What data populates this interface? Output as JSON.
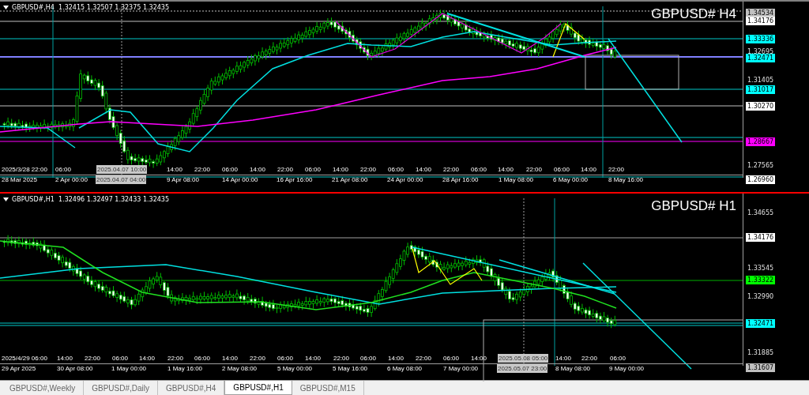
{
  "panels": [
    {
      "active": false,
      "header": "GBPUSD#,H4  1.32415 1.32507 1.32375 1.32435",
      "title": "GBPUSD# H4",
      "price_labels": [
        {
          "text": "1.34534",
          "kind": "box",
          "color": "#c0c0c0"
        },
        {
          "text": "1.34176",
          "kind": "box",
          "color": "#ffffff"
        },
        {
          "text": "1.33336",
          "kind": "box",
          "color": "#00ffff"
        },
        {
          "text": "1.32695",
          "kind": "plain"
        },
        {
          "text": "1.32471",
          "kind": "box",
          "color": "#00ffff"
        },
        {
          "text": "1.31405",
          "kind": "plain"
        },
        {
          "text": "1.31017",
          "kind": "box",
          "color": "#00ffff"
        },
        {
          "text": "1.30270",
          "kind": "box",
          "color": "#ffffff"
        },
        {
          "text": "1.28667",
          "kind": "box",
          "color": "#ff00ff"
        },
        {
          "text": "1.27565",
          "kind": "plain"
        },
        {
          "text": "1.26960",
          "kind": "box",
          "color": "#ffffff"
        }
      ],
      "hour_labels": [
        {
          "text": "2025/3/28 22:00",
          "highlighted": false
        },
        {
          "text": "06:00",
          "highlighted": false
        },
        {
          "text": "2025.04.07 10:00",
          "highlighted": true
        },
        {
          "text": "14:00",
          "highlighted": false
        },
        {
          "text": "22:00",
          "highlighted": false
        },
        {
          "text": "06:00",
          "highlighted": false
        },
        {
          "text": "14:00",
          "highlighted": false
        },
        {
          "text": "22:00",
          "highlighted": false
        },
        {
          "text": "06:00",
          "highlighted": false
        },
        {
          "text": "14:00",
          "highlighted": false
        },
        {
          "text": "22:00",
          "highlighted": false
        },
        {
          "text": "06:00",
          "highlighted": false
        },
        {
          "text": "14:00",
          "highlighted": false
        },
        {
          "text": "22:00",
          "highlighted": false
        },
        {
          "text": "06:00",
          "highlighted": false
        },
        {
          "text": "14:00",
          "highlighted": false
        },
        {
          "text": "22:00",
          "highlighted": false
        },
        {
          "text": "06:00",
          "highlighted": false
        },
        {
          "text": "14:00",
          "highlighted": false
        },
        {
          "text": "22:00",
          "highlighted": false
        }
      ],
      "date_labels": [
        {
          "text": "28 Mar 2025",
          "highlighted": false
        },
        {
          "text": "2 Apr 00:00",
          "highlighted": false
        },
        {
          "text": "2025.04.07 04:00",
          "highlighted": true
        },
        {
          "text": "9 Apr 08:00",
          "highlighted": false
        },
        {
          "text": "14 Apr 00:00",
          "highlighted": false
        },
        {
          "text": "16 Apr 16:00",
          "highlighted": false
        },
        {
          "text": "21 Apr 08:00",
          "highlighted": false
        },
        {
          "text": "24 Apr 00:00",
          "highlighted": false
        },
        {
          "text": "28 Apr 16:00",
          "highlighted": false
        },
        {
          "text": "1 May 08:00",
          "highlighted": false
        },
        {
          "text": "6 May 00:00",
          "highlighted": false
        },
        {
          "text": "8 May 16:00",
          "highlighted": false
        }
      ]
    },
    {
      "active": true,
      "header": "GBPUSD#,H1  1.32496 1.32497 1.32433 1.32435",
      "title": "GBPUSD# H1",
      "price_labels": [
        {
          "text": "1.34655",
          "kind": "plain"
        },
        {
          "text": "1.34176",
          "kind": "box",
          "color": "#ffffff"
        },
        {
          "text": "1.33545",
          "kind": "plain"
        },
        {
          "text": "1.33322",
          "kind": "box",
          "color": "#00ff00"
        },
        {
          "text": "1.32990",
          "kind": "plain"
        },
        {
          "text": "1.32471",
          "kind": "box",
          "color": "#00ffff"
        },
        {
          "text": "1.31885",
          "kind": "plain"
        },
        {
          "text": "1.31607",
          "kind": "box",
          "color": "#c0c0c0"
        }
      ],
      "hour_labels": [
        {
          "text": "2025/4/29 06:00",
          "highlighted": false
        },
        {
          "text": "14:00",
          "highlighted": false
        },
        {
          "text": "22:00",
          "highlighted": false
        },
        {
          "text": "06:00",
          "highlighted": false
        },
        {
          "text": "14:00",
          "highlighted": false
        },
        {
          "text": "22:00",
          "highlighted": false
        },
        {
          "text": "06:00",
          "highlighted": false
        },
        {
          "text": "14:00",
          "highlighted": false
        },
        {
          "text": "22:00",
          "highlighted": false
        },
        {
          "text": "06:00",
          "highlighted": false
        },
        {
          "text": "14:00",
          "highlighted": false
        },
        {
          "text": "22:00",
          "highlighted": false
        },
        {
          "text": "06:00",
          "highlighted": false
        },
        {
          "text": "14:00",
          "highlighted": false
        },
        {
          "text": "22:00",
          "highlighted": false
        },
        {
          "text": "06:00",
          "highlighted": false
        },
        {
          "text": "14:00",
          "highlighted": false
        },
        {
          "text": "2025.05.08 05:00",
          "highlighted": true
        },
        {
          "text": "14:00",
          "highlighted": false
        },
        {
          "text": "22:00",
          "highlighted": false
        },
        {
          "text": "06:00",
          "highlighted": false
        }
      ],
      "date_labels": [
        {
          "text": "29 Apr 2025",
          "highlighted": false
        },
        {
          "text": "30 Apr 08:00",
          "highlighted": false
        },
        {
          "text": "1 May 00:00",
          "highlighted": false
        },
        {
          "text": "1 May 16:00",
          "highlighted": false
        },
        {
          "text": "2 May 08:00",
          "highlighted": false
        },
        {
          "text": "5 May 00:00",
          "highlighted": false
        },
        {
          "text": "5 May 16:00",
          "highlighted": false
        },
        {
          "text": "6 May 08:00",
          "highlighted": false
        },
        {
          "text": "7 May 00:00",
          "highlighted": false
        },
        {
          "text": "2025.05.07 23:00",
          "highlighted": true
        },
        {
          "text": "8 May 08:00",
          "highlighted": false
        },
        {
          "text": "9 May 00:00",
          "highlighted": false
        }
      ]
    }
  ],
  "tabs": [
    {
      "label": "GBPUSD#,Weekly",
      "selected": false
    },
    {
      "label": "GBPUSD#,Daily",
      "selected": false
    },
    {
      "label": "GBPUSD#,H4",
      "selected": false
    },
    {
      "label": "GBPUSD#,H1",
      "selected": true
    },
    {
      "label": "GBPUSD#,M15",
      "selected": false
    }
  ]
}
